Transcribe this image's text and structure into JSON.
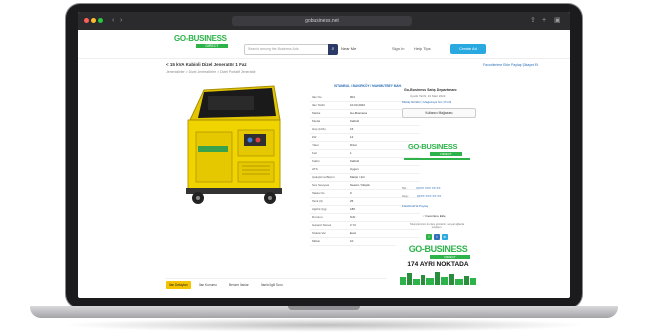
{
  "browser": {
    "url": "gobusiness.net",
    "back_icon": "chevron-left-icon",
    "forward_icon": "chevron-right-icon",
    "share_icon": "share-icon",
    "add_tab_icon": "plus-icon",
    "tabs_icon": "tabs-icon"
  },
  "header": {
    "logo_text": "GO-BUSINESS",
    "logo_sub": "DIRECT",
    "search_placeholder": "Search among the Business Ads",
    "search_label": "Near Me",
    "nav": [
      "Sign In",
      "Help Tips"
    ],
    "cta_label": "Create Ad",
    "accent": "#29a9e0",
    "brand": "#2db34a"
  },
  "listing": {
    "title": "< 15 kVA Kabinli Dizel Jeneratör 1 Faz",
    "breadcrumb": "Jeneratörler > Dizel Jeneratörler > Dizel Portatif Jeneratör",
    "top_links": "Favorilerime Ekle  Paylaş  Şikayet Et",
    "spec_header": "ISTANBUL / BAKIRKÖY / MAHMUTBEY MAH.",
    "specs": [
      {
        "k": "Ilan No",
        "v": "901"
      },
      {
        "k": "Ilan Tarihi",
        "v": "10.03.2022"
      },
      {
        "k": "Marka",
        "v": "Go-Business"
      },
      {
        "k": "Model",
        "v": "Kabinli"
      },
      {
        "k": "Güç (kVA)",
        "v": "15"
      },
      {
        "k": "kW",
        "v": "12"
      },
      {
        "k": "Yakıt",
        "v": "Dizel"
      },
      {
        "k": "Faz",
        "v": "1"
      },
      {
        "k": "Kabin",
        "v": "Kabinli"
      },
      {
        "k": "ATS",
        "v": "Uygun"
      },
      {
        "k": "Çalıştırma Biçimi",
        "v": "Marşlı / Ipli"
      },
      {
        "k": "Ses Seviyesi",
        "v": "Sessiz / Düşük"
      },
      {
        "k": "Takas No",
        "v": "0"
      },
      {
        "k": "Tank (lt)",
        "v": "25"
      },
      {
        "k": "Ağırlık (kg)",
        "v": "180"
      },
      {
        "k": "Durumu",
        "v": "Sıfır"
      },
      {
        "k": "Garanti Süresi",
        "v": "2 Yıl"
      },
      {
        "k": "Stokta Var",
        "v": "Evet"
      },
      {
        "k": "Miktar",
        "v": "10"
      }
    ]
  },
  "seller": {
    "name": "Go-Business Satış Departmanı",
    "since": "Üyelik Tarihi: 10 Mart 2022",
    "links": "Mesaj Gönder | Mağazaya Git | Profil",
    "message_button": "Kullanıcı Mağazası",
    "logo_text": "GO-BUSINESS",
    "logo_sub": "DIRECT",
    "phone_label": "Tel :",
    "phone_value": "0XXX XXX XX XX",
    "mobile_label": "Cep :",
    "mobile_value": "0XXX XXX XX XX",
    "facebook_link": "Facebook'ta Paylaş",
    "favorite_label": "Favorilere Ekle",
    "share_note": "Takipçilerinize bu ilanı gönderin, sosyal ağlarda paylaşın.",
    "share_icons": [
      "f",
      "t",
      "in"
    ]
  },
  "banner": {
    "logo_text": "GO-BUSINESS",
    "logo_sub": "DIRECT",
    "text": "174 AYRI NOKTADA"
  },
  "tabs": [
    "İlan Detayları",
    "İlan Konumu",
    "Benzer İlanlar",
    "İlanla İlgili Soru"
  ]
}
